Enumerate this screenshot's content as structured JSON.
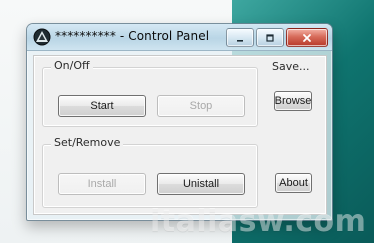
{
  "window": {
    "title": "********** - Control Panel",
    "controls": {
      "minimize_icon": "minimize-icon",
      "maximize_icon": "maximize-icon",
      "close_icon": "close-icon"
    }
  },
  "groups": {
    "onoff": {
      "label": "On/Off",
      "start_label": "Start",
      "stop_label": "Stop"
    },
    "setremove": {
      "label": "Set/Remove",
      "install_label": "Install",
      "uninstall_label": "Unistall"
    }
  },
  "side": {
    "save_label": "Save...",
    "browse_label": "Browse",
    "about_label": "About"
  },
  "watermark": {
    "text": "italiasw.com"
  },
  "colors": {
    "accent_teal": "#0f746f",
    "close_red": "#c0392b"
  }
}
